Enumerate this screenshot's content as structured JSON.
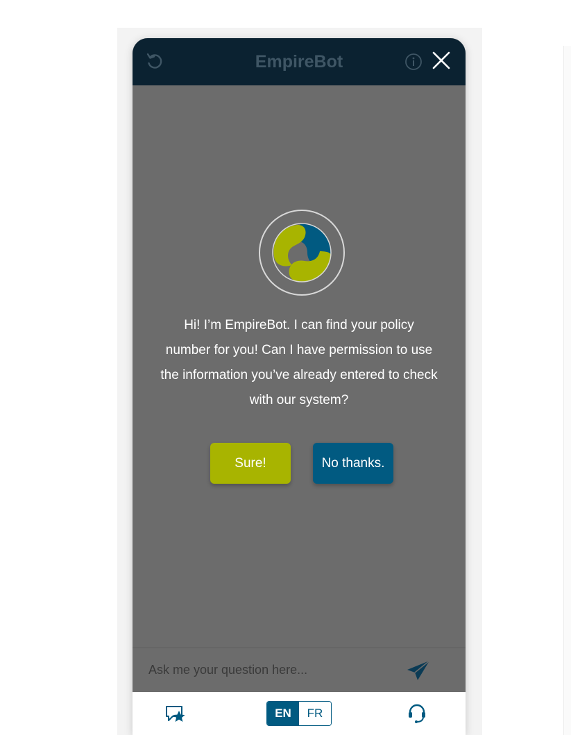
{
  "header": {
    "title": "EmpireBot",
    "refresh_icon": "refresh-icon",
    "info_icon": "info-icon",
    "close_icon": "close-icon"
  },
  "dialog": {
    "logo_icon": "empire-logo",
    "message": "Hi! I’m EmpireBot. I can find your policy number for you! Can I have permission to use the information you’ve already entered to check with our system?",
    "accept_label": "Sure!",
    "decline_label": "No thanks."
  },
  "composer": {
    "placeholder": "Ask me your question here...",
    "send_icon": "send-icon"
  },
  "footer": {
    "favorites_icon": "chat-star-icon",
    "languages": [
      {
        "code": "EN",
        "active": true
      },
      {
        "code": "FR",
        "active": false
      }
    ],
    "agent_icon": "headset-icon"
  },
  "colors": {
    "header_bg": "#0b2231",
    "overlay_bg": "#6c6c6c",
    "accept_green": "#a8b400",
    "decline_blue": "#015a81",
    "brand_blue": "#015a81"
  }
}
